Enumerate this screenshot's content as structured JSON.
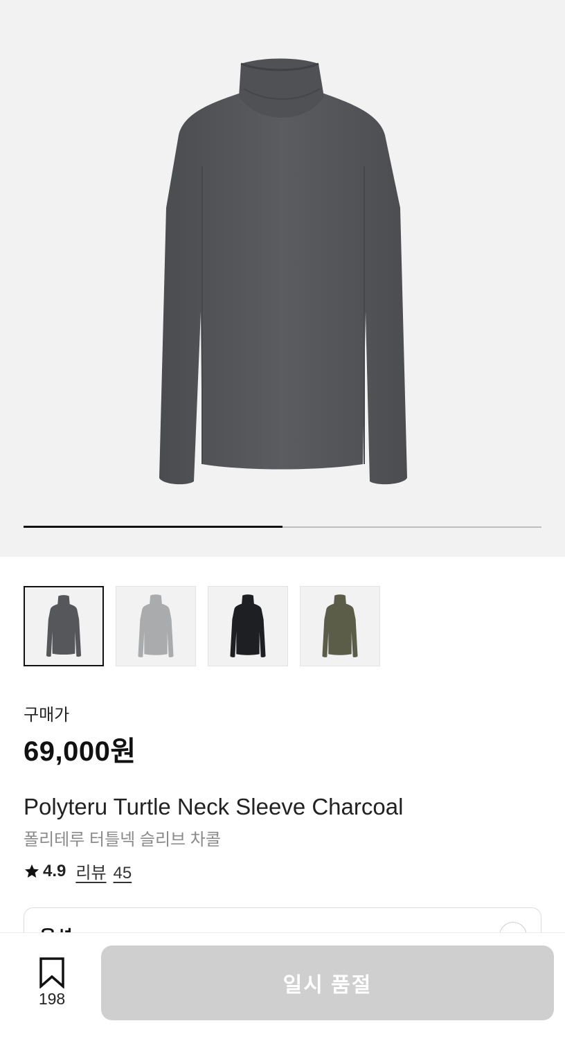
{
  "gallery": {
    "progress_fraction": 0.5,
    "images": [
      {
        "icon": "turtleneck-charcoal-image",
        "color": "#55575a"
      },
      {
        "icon": "turtleneck-lightgray-image",
        "color": "#a9abad"
      },
      {
        "icon": "turtleneck-black-image",
        "color": "#1e1f22"
      },
      {
        "icon": "turtleneck-khaki-image",
        "color": "#5b5d48"
      }
    ],
    "active_index": 0
  },
  "product": {
    "price_label": "구매가",
    "price": "69,000원",
    "name_en": "Polyteru Turtle Neck Sleeve Charcoal",
    "name_ko": "폴리테루 터틀넥 슬리브 차콜",
    "rating": "4.9",
    "review_label": "리뷰",
    "review_count": "45"
  },
  "option": {
    "label": "옵션"
  },
  "bottom_bar": {
    "bookmark_count": "198",
    "soldout_label": "일시 품절"
  }
}
